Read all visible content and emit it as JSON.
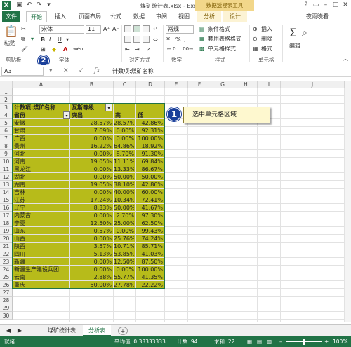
{
  "window": {
    "title": "煤矿统计表.xlsx - Excel",
    "pivot_tools": "数据透视表工具",
    "user": "夜雨晓看",
    "help": "?"
  },
  "tabs": [
    "文件",
    "开始",
    "插入",
    "页面布局",
    "公式",
    "数据",
    "审阅",
    "视图",
    "分析",
    "设计"
  ],
  "ribbon": {
    "paste_label": "粘贴",
    "font_name": "宋体",
    "font_size": "11",
    "bold": "B",
    "italic": "I",
    "underline": "U",
    "wen": "wén",
    "number_format": "常规",
    "percent": "%",
    "comma": ",",
    "cond_format": "条件格式",
    "table_format": "套用表格格式",
    "cell_style": "单元格样式",
    "insert": "插入",
    "delete": "删除",
    "format": "格式",
    "edit_label": "编辑",
    "groups": {
      "clipboard": "剪贴板",
      "font": "字体",
      "alignment": "对齐方式",
      "number": "数字",
      "styles": "样式",
      "cells": "单元格"
    }
  },
  "formula_bar": {
    "name_box": "A3",
    "fx": "fx",
    "formula": "计数项:煤矿名称"
  },
  "columns": [
    "A",
    "B",
    "C",
    "D",
    "E",
    "F",
    "G",
    "H",
    "I",
    "J"
  ],
  "rows": [
    "1",
    "2",
    "3",
    "4",
    "5",
    "6",
    "7",
    "8",
    "9",
    "10",
    "11",
    "12",
    "13",
    "14",
    "15",
    "16",
    "17",
    "18",
    "19",
    "20",
    "21",
    "22",
    "23",
    "24",
    "25",
    "26",
    "27",
    "28",
    "29",
    "30"
  ],
  "pivot": {
    "header_a3": "计数项:煤矿名称",
    "header_b3": "瓦斯等级",
    "header_a4": "省份",
    "header_b4": "突出",
    "header_c4": "高",
    "header_d4": "低",
    "rows": [
      {
        "province": "安徽",
        "tuchu": "28.57%",
        "gao": "28.57%",
        "di": "42.86%"
      },
      {
        "province": "甘肃",
        "tuchu": "7.69%",
        "gao": "0.00%",
        "di": "92.31%"
      },
      {
        "province": "广西",
        "tuchu": "0.00%",
        "gao": "0.00%",
        "di": "100.00%"
      },
      {
        "province": "贵州",
        "tuchu": "16.22%",
        "gao": "64.86%",
        "di": "18.92%"
      },
      {
        "province": "河北",
        "tuchu": "0.00%",
        "gao": "8.70%",
        "di": "91.30%"
      },
      {
        "province": "河南",
        "tuchu": "19.05%",
        "gao": "11.11%",
        "di": "69.84%"
      },
      {
        "province": "黑龙江",
        "tuchu": "0.00%",
        "gao": "13.33%",
        "di": "86.67%"
      },
      {
        "province": "湖北",
        "tuchu": "0.00%",
        "gao": "50.00%",
        "di": "50.00%"
      },
      {
        "province": "湖南",
        "tuchu": "19.05%",
        "gao": "38.10%",
        "di": "42.86%"
      },
      {
        "province": "吉林",
        "tuchu": "0.00%",
        "gao": "40.00%",
        "di": "60.00%"
      },
      {
        "province": "江苏",
        "tuchu": "17.24%",
        "gao": "10.34%",
        "di": "72.41%"
      },
      {
        "province": "辽宁",
        "tuchu": "8.33%",
        "gao": "50.00%",
        "di": "41.67%"
      },
      {
        "province": "内蒙古",
        "tuchu": "0.00%",
        "gao": "2.70%",
        "di": "97.30%"
      },
      {
        "province": "宁夏",
        "tuchu": "12.50%",
        "gao": "25.00%",
        "di": "62.50%"
      },
      {
        "province": "山东",
        "tuchu": "0.57%",
        "gao": "0.00%",
        "di": "99.43%"
      },
      {
        "province": "山西",
        "tuchu": "0.00%",
        "gao": "25.76%",
        "di": "74.24%"
      },
      {
        "province": "陕西",
        "tuchu": "3.57%",
        "gao": "10.71%",
        "di": "85.71%"
      },
      {
        "province": "四川",
        "tuchu": "5.13%",
        "gao": "53.85%",
        "di": "41.03%"
      },
      {
        "province": "新疆",
        "tuchu": "0.00%",
        "gao": "12.50%",
        "di": "87.50%"
      },
      {
        "province": "新疆生产建设兵团",
        "tuchu": "0.00%",
        "gao": "0.00%",
        "di": "100.00%"
      },
      {
        "province": "云南",
        "tuchu": "2.88%",
        "gao": "55.77%",
        "di": "41.35%"
      },
      {
        "province": "重庆",
        "tuchu": "50.00%",
        "gao": "27.78%",
        "di": "22.22%"
      }
    ]
  },
  "callout": {
    "badge": "1",
    "text": "选中单元格区域"
  },
  "badge2": "2",
  "sheets": {
    "tab1": "煤矿统计表",
    "tab2": "分析表",
    "nav_prev": "◀",
    "nav_next": "▶",
    "add": "+"
  },
  "status": {
    "ready": "就绪",
    "average": "平均值: 0.33333333",
    "count": "计数: 94",
    "sum": "求和: 22",
    "zoom": "100%"
  },
  "colors": {
    "excel_green": "#217346",
    "selection_fill": "#b7bb1a",
    "pivot_tools_bg": "#f2d78a",
    "badge_blue": "#1a3f9a"
  }
}
